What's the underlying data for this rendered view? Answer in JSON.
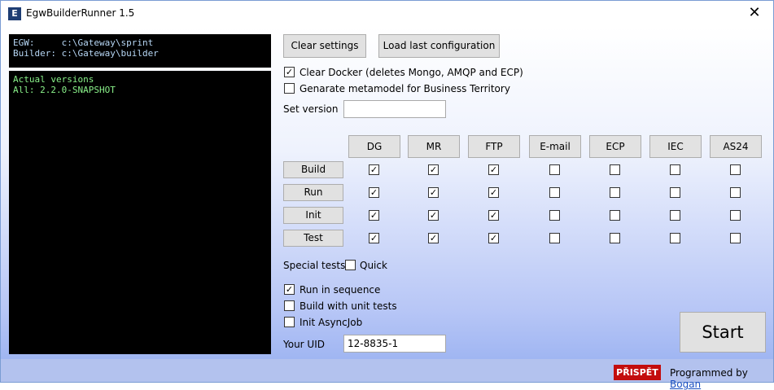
{
  "window": {
    "title": "EgwBuilderRunner 1.5",
    "app_icon_letter": "E",
    "close_glyph": "✕"
  },
  "console": {
    "paths_lines": [
      "EGW:     c:\\Gateway\\sprint",
      "Builder: c:\\Gateway\\builder"
    ],
    "versions_lines": [
      "Actual versions",
      "All: 2.2.0-SNAPSHOT"
    ]
  },
  "toolbar": {
    "clear_settings": "Clear settings",
    "load_last": "Load last configuration"
  },
  "options": {
    "clear_docker": {
      "label": "Clear Docker (deletes Mongo, AMQP and ECP)",
      "checked": true
    },
    "generate_metamodel": {
      "label": "Genarate metamodel for Business Territory",
      "checked": false
    }
  },
  "set_version": {
    "label": "Set version",
    "value": ""
  },
  "matrix": {
    "columns": [
      "DG",
      "MR",
      "FTP",
      "E-mail",
      "ECP",
      "IEC",
      "AS24"
    ],
    "rows": [
      {
        "label": "Build",
        "checks": [
          true,
          true,
          true,
          false,
          false,
          false,
          false
        ]
      },
      {
        "label": "Run",
        "checks": [
          true,
          true,
          true,
          false,
          false,
          false,
          false
        ]
      },
      {
        "label": "Init",
        "checks": [
          true,
          true,
          true,
          false,
          false,
          false,
          false
        ]
      },
      {
        "label": "Test",
        "checks": [
          true,
          true,
          true,
          false,
          false,
          false,
          false
        ]
      }
    ]
  },
  "special_tests": {
    "label": "Special tests:",
    "quick": {
      "label": "Quick",
      "checked": false
    }
  },
  "run_options": {
    "run_in_sequence": {
      "label": "Run in sequence",
      "checked": true
    },
    "build_with_unit_tests": {
      "label": "Build with unit tests",
      "checked": false
    },
    "init_asyncjob": {
      "label": "Init AsyncJob",
      "checked": false
    }
  },
  "uid": {
    "label": "Your UID",
    "value": "12-8835-1"
  },
  "start_label": "Start",
  "footer": {
    "donate": "PŘISPĚT",
    "credit_prefix": "Programmed by",
    "credit_link": "Bogan"
  },
  "check_glyph": "✓"
}
